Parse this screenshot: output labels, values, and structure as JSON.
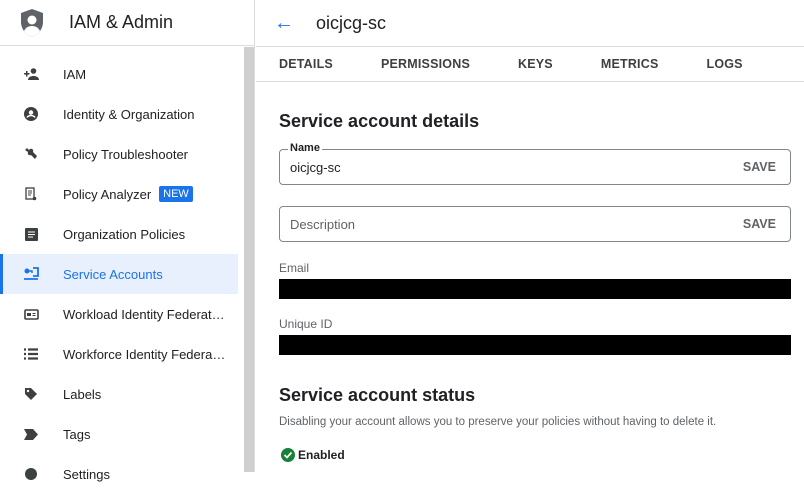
{
  "sidebar": {
    "title": "IAM & Admin",
    "items": [
      {
        "label": "IAM",
        "icon": "person-add-icon"
      },
      {
        "label": "Identity & Organization",
        "icon": "account-circle-icon"
      },
      {
        "label": "Policy Troubleshooter",
        "icon": "wrench-icon"
      },
      {
        "label": "Policy Analyzer",
        "icon": "document-search-icon",
        "badge": "NEW"
      },
      {
        "label": "Organization Policies",
        "icon": "article-icon"
      },
      {
        "label": "Service Accounts",
        "icon": "service-account-icon",
        "active": true
      },
      {
        "label": "Workload Identity Federat…",
        "icon": "id-card-icon"
      },
      {
        "label": "Workforce Identity Federa…",
        "icon": "list-icon"
      },
      {
        "label": "Labels",
        "icon": "label-icon"
      },
      {
        "label": "Tags",
        "icon": "tag-icon"
      },
      {
        "label": "Settings",
        "icon": "settings-icon"
      }
    ]
  },
  "header": {
    "title": "oicjcg-sc"
  },
  "tabs": [
    "DETAILS",
    "PERMISSIONS",
    "KEYS",
    "METRICS",
    "LOGS"
  ],
  "details": {
    "heading": "Service account details",
    "name_label": "Name",
    "name_value": "oicjcg-sc",
    "save": "SAVE",
    "description_placeholder": "Description",
    "email_label": "Email",
    "unique_id_label": "Unique ID"
  },
  "status": {
    "heading": "Service account status",
    "description": "Disabling your account allows you to preserve your policies without having to delete it.",
    "value": "Enabled",
    "color": "#188038"
  },
  "accent": "#1a73e8"
}
